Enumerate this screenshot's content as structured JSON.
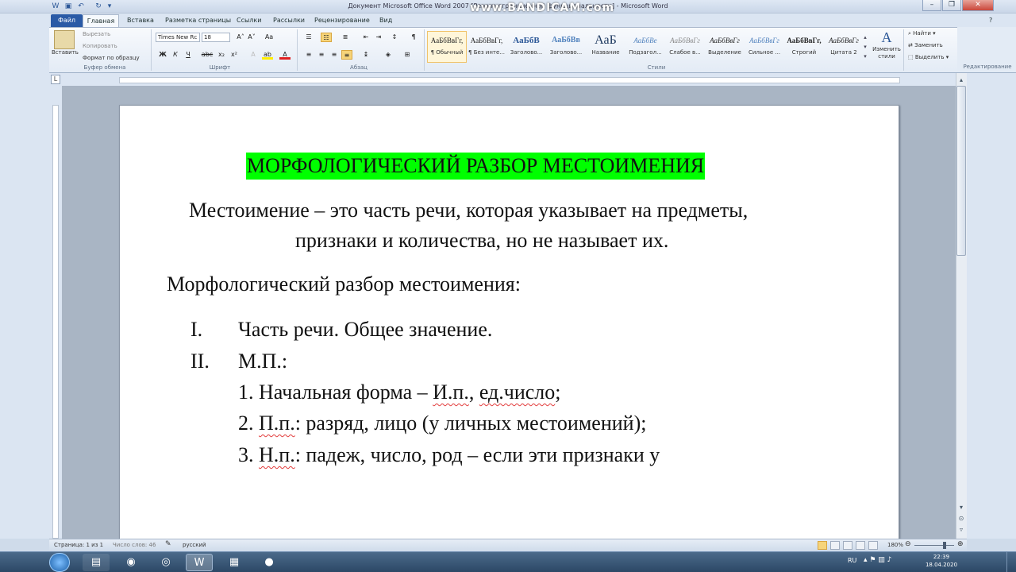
{
  "window": {
    "title": "Документ Microsoft Office Word 2007 [Режим ограниченной функциональности] - Microsoft Word",
    "recorder_watermark": "www.BANDICAM.com"
  },
  "tabs": [
    "Файл",
    "Главная",
    "Вставка",
    "Разметка страницы",
    "Ссылки",
    "Рассылки",
    "Рецензирование",
    "Вид"
  ],
  "clipboard": {
    "paste": "Вставить",
    "cut": "Вырезать",
    "copy": "Копировать",
    "format_painter": "Формат по образцу",
    "group": "Буфер обмена"
  },
  "font": {
    "name": "Times New Rc",
    "size": "18",
    "group": "Шрифт",
    "bold": "Ж",
    "italic": "К",
    "underline": "Ч",
    "strike": "abc",
    "sub": "x₂",
    "sup": "x²",
    "grow": "A˄",
    "shrink": "A˅",
    "case": "Aa"
  },
  "paragraph": {
    "group": "Абзац",
    "marks": "¶"
  },
  "styles": {
    "group": "Стили",
    "items": [
      {
        "sample": "АаБбВвГг,",
        "name": "¶ Обычный"
      },
      {
        "sample": "АаБбВвГг,",
        "name": "¶ Без инте..."
      },
      {
        "sample": "АаБбВ",
        "name": "Заголово..."
      },
      {
        "sample": "АаБбВв",
        "name": "Заголово..."
      },
      {
        "sample": "АаБ",
        "name": "Название"
      },
      {
        "sample": "АаБбВе",
        "name": "Подзагол..."
      },
      {
        "sample": "АаБбВвГг",
        "name": "Слабое в..."
      },
      {
        "sample": "АаБбВвГг",
        "name": "Выделение"
      },
      {
        "sample": "АаБбВвГг",
        "name": "Сильное ..."
      },
      {
        "sample": "АаБбВвГг,",
        "name": "Строгий"
      },
      {
        "sample": "АаБбВвГг",
        "name": "Цитата 2"
      }
    ],
    "change": "Изменить стили"
  },
  "editing": {
    "group": "Редактирование",
    "find": "Найти",
    "replace": "Заменить",
    "select": "Выделить"
  },
  "ruler_tab": "L",
  "document": {
    "title": "МОРФОЛОГИЧЕСКИЙ РАЗБОР МЕСТОИМЕНИЯ",
    "def_line1": "Местоимение – это часть речи, которая указывает на предметы,",
    "def_line2": "признаки и количества, но не называет их.",
    "subhead": "Морфологический разбор местоимения:",
    "items": [
      {
        "num": "I.",
        "text": "Часть речи. Общее значение."
      },
      {
        "num": "II.",
        "text": "М.П.:"
      }
    ],
    "sub1_pre": "1. Начальная форма – ",
    "sub1_a": "И.п.",
    ", ": "",
    "sub1_mid": ", ",
    "sub1_b": "ед.число",
    ";": "",
    "sub1_end": ";",
    "sub2_num": "2. ",
    "sub2_a": "П.п.",
    "sub2_rest": ": разряд, лицо (у личных местоимений);",
    "sub3_num": "3. ",
    "sub3_a": "Н.п.",
    "sub3_rest": ": падеж, число, род – если эти признаки у"
  },
  "status": {
    "page": "Страница: 1 из 1",
    "words": "Число слов: 46",
    "lang": "русский",
    "zoom": "180%"
  },
  "taskbar": {
    "lang": "RU",
    "time": "22:39",
    "date": "18.04.2020"
  },
  "colors": {
    "highlight": "#00ff00",
    "file_tab": "#2a5aa6",
    "squiggle": "#e23b3b"
  }
}
